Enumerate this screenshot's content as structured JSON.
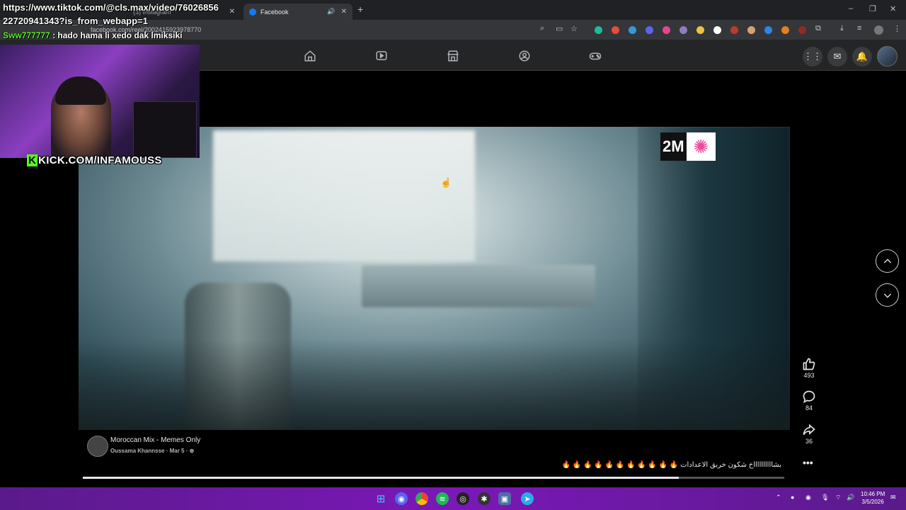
{
  "browser": {
    "tabs": [
      {
        "label": "(3) Instagram",
        "active": false
      },
      {
        "label": "Facebook",
        "active": true
      }
    ],
    "new_tab": "+",
    "url": "facebook.com/reel/2002415923978770",
    "window_controls": {
      "minimize": "–",
      "maximize": "❐",
      "close": "✕"
    }
  },
  "overlay": {
    "link_line1": "https://www.tiktok.com/@cls.max/video/76026856",
    "link_line2": "22720941343?is_from_webapp=1",
    "chat_user": "Sww777777",
    "chat_message": ": hado hama li xedo dak lmiksiki",
    "kick_badge": "K",
    "kick_text": "KICK.COM/INFAMOUSS"
  },
  "video": {
    "channel_logo": "2M",
    "progress": 0.85
  },
  "actions": {
    "likes": "493",
    "comments": "84",
    "shares": "36",
    "more": "•••"
  },
  "post": {
    "page_name": "Moroccan Mix - Memes Only",
    "author": "Oussama Khannsse",
    "date": "· Mar 5 ·",
    "caption": "بشااااااااااخ شكون خربق الاعدادات 🔥 🔥 🔥 🔥 🔥 🔥 🔥 🔥 🔥 🔥 🔥"
  },
  "taskbar": {
    "time": "10:46 PM",
    "date": "3/5/2026"
  },
  "colors": {
    "facebook_blue": "#1877f2",
    "kick_green": "#53fc18",
    "taskbar_purple": "#7a18b8"
  }
}
